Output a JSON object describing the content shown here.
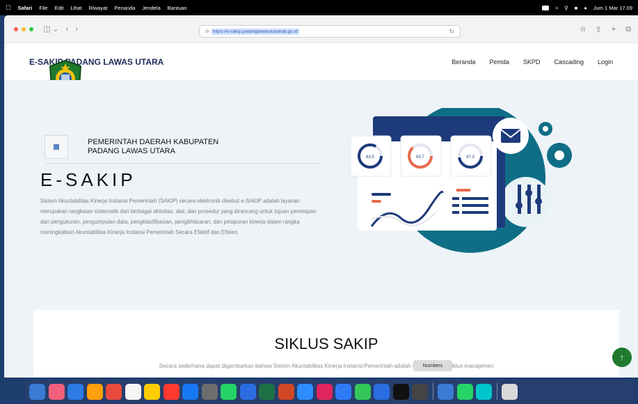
{
  "menubar": {
    "app": "Safari",
    "items": [
      "File",
      "Edit",
      "Lihat",
      "Riwayat",
      "Penanda",
      "Jendela",
      "Bantuan"
    ],
    "clock": "Jum 1 Mar  17.09"
  },
  "browser": {
    "url": "https://e-sakip.padanglawasutarakab.go.id"
  },
  "site": {
    "brand": "E-SAKIP PADANG LAWAS UTARA",
    "nav": [
      "Beranda",
      "Pemda",
      "SKPD",
      "Cascading",
      "Login"
    ],
    "pemda_label": "PEMERINTAH DAERAH KABUPATEN PADANG LAWAS UTARA",
    "hero_title": "E-SAKIP",
    "hero_desc": "Sistem Akuntabilitas Kinerja Instansi Pemerintah (SAKIP) secara elektronik disebut e-SAKIP adalah layanan merupakan rangkaian sistematik dari berbagai aktivitas, alat, dan prosedur yang dirancang untuk tujuan penetapan dan pengukuran, pengumpulan data, pengklasifikasian, pengikhtisaran, dan pelaporan kinerja dalam rangka meningkatkan Akuntabilitas Kinerja Instansi Pemerintah Secara Efektif dan Efisien.",
    "stats": [
      "83.5",
      "63.7",
      "47.3"
    ],
    "section_title": "SIKLUS SAKIP",
    "section_text": "Secara sederhana dapat digambarkan bahwa Sistem Akuntabilitas Kinerja Instansi Pemerintah adalah satu-kesatuan siklus manajemen"
  },
  "dock": {
    "tooltip": "Numbers",
    "colors": [
      "#3a7bd5",
      "#f25f7a",
      "#2c7be5",
      "#ff9f0a",
      "#e84b3c",
      "#f5f5f5",
      "#ffcc00",
      "#ff3b30",
      "#1877f2",
      "#6d6d6d",
      "#25d366",
      "#2b6de0",
      "#1e7145",
      "#d24726",
      "#2d8cff",
      "#e0245e",
      "#2f7bf6",
      "#33c759",
      "#2b6de0",
      "#111111",
      "#444444",
      "#3a7bd5",
      "#25d366",
      "#00c4cc",
      "#d9d9d9"
    ]
  }
}
